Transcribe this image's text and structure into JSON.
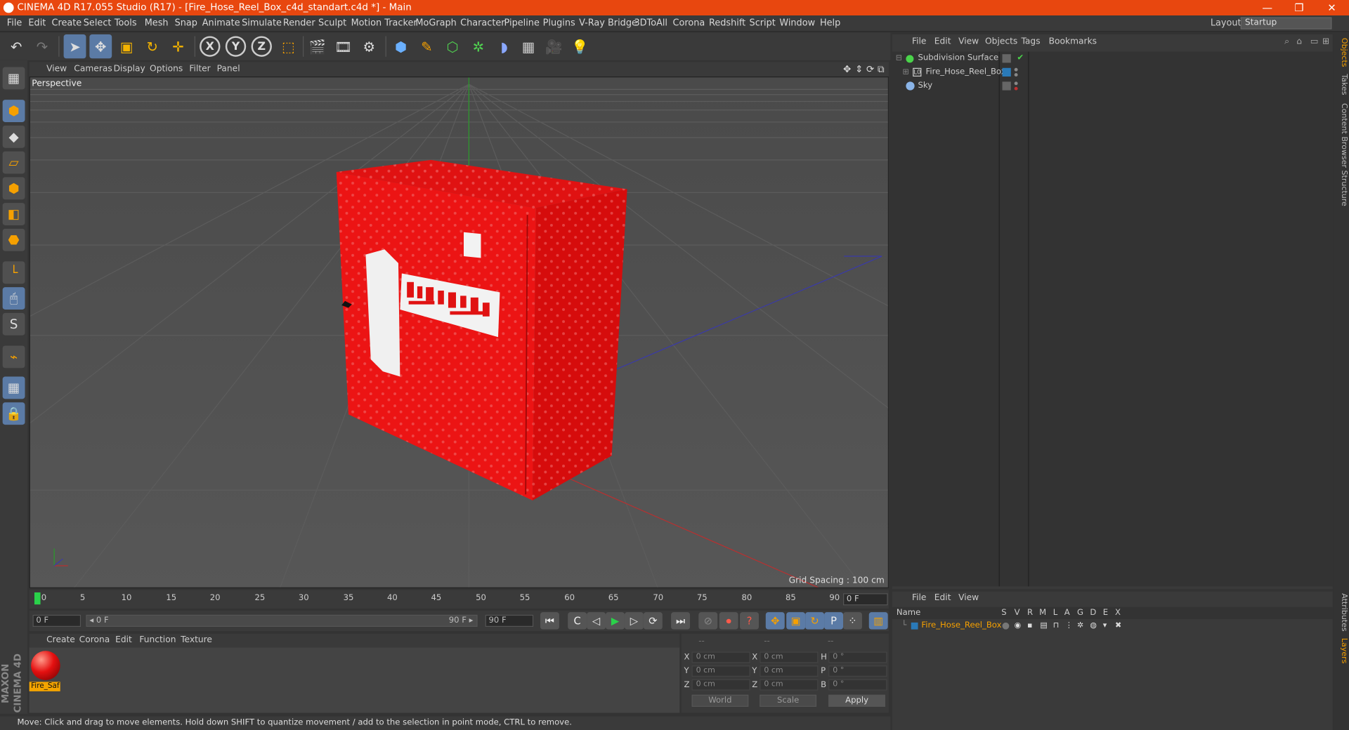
{
  "titlebar": {
    "title": "CINEMA 4D R17.055 Studio (R17) - [Fire_Hose_Reel_Box_c4d_standart.c4d *] - Main",
    "minimize": "—",
    "restore": "❐",
    "close": "✕"
  },
  "menubar": {
    "items": [
      "File",
      "Edit",
      "Create",
      "Select",
      "Tools",
      "Mesh",
      "Snap",
      "Animate",
      "Simulate",
      "Render",
      "Sculpt",
      "Motion Tracker",
      "MoGraph",
      "Character",
      "Pipeline",
      "Plugins",
      "V-Ray Bridge",
      "3DToAll",
      "Corona",
      "Redshift",
      "Script",
      "Window",
      "Help"
    ],
    "layout_label": "Layout:",
    "layout_value": "Startup"
  },
  "toolbar": {
    "undo": "↶",
    "redo": "↷",
    "select": "➤",
    "move": "✥",
    "scale": "▣",
    "rotate": "↻",
    "add": "✛",
    "x": "X",
    "y": "Y",
    "z": "Z",
    "coord": "⬚",
    "render_view": "🎬",
    "render_pv": "🎞",
    "render_settings": "⚙",
    "cube": "⬢",
    "pen": "✎",
    "subdivide": "⬡",
    "mograph": "✲",
    "deformer": "◗",
    "floor": "▦",
    "camera": "🎥",
    "light": "💡"
  },
  "lefttools": {
    "model": "▦",
    "mesh_pts": "◆",
    "edges": "▱",
    "polys": "⬢",
    "uvw": "◧",
    "object": "⬢",
    "texture": "⬣",
    "axis": "└",
    "tweak": "🖱",
    "snap": "S",
    "magnet": "⌁",
    "workplane": "▦",
    "lock": "🔒"
  },
  "maxon_logo": "MAXON CINEMA 4D",
  "viewport": {
    "menu": [
      "View",
      "Cameras",
      "Display",
      "Options",
      "Filter",
      "Panel"
    ],
    "label": "Perspective",
    "grid_spacing": "Grid Spacing : 100 cm",
    "nav": [
      "✥",
      "⇕",
      "⟳",
      "⧉"
    ]
  },
  "timeline": {
    "ticks": [
      "0",
      "5",
      "10",
      "15",
      "20",
      "25",
      "30",
      "35",
      "40",
      "45",
      "50",
      "55",
      "60",
      "65",
      "70",
      "75",
      "80",
      "85",
      "90"
    ],
    "current": "0 F"
  },
  "transport": {
    "start": "0 F",
    "range_start": "◂ 0 F",
    "range_end": "90 F ▸",
    "end": "90 F",
    "buttons": {
      "first": "⏮",
      "prev_key": "C",
      "prev": "◁",
      "play": "▶",
      "next": "▷",
      "loop": "⟳",
      "last": "⏭"
    },
    "rec": {
      "keyframe": "⊘",
      "autokey": "⏺",
      "question": "?",
      "move": "✥",
      "scale": "▣",
      "rotate": "↻",
      "param": "P",
      "dots": "⁘",
      "film": "▥"
    }
  },
  "materials": {
    "menu": [
      "Create",
      "Corona",
      "Edit",
      "Function",
      "Texture"
    ],
    "items": [
      {
        "name": "Fire_Saf"
      }
    ]
  },
  "coords": {
    "header": [
      "--",
      "--",
      "--"
    ],
    "rows": [
      {
        "a": "X",
        "av": "0 cm",
        "b": "X",
        "bv": "0 cm",
        "c": "H",
        "cv": "0 °"
      },
      {
        "a": "Y",
        "av": "0 cm",
        "b": "Y",
        "bv": "0 cm",
        "c": "P",
        "cv": "0 °"
      },
      {
        "a": "Z",
        "av": "0 cm",
        "b": "Z",
        "bv": "0 cm",
        "c": "B",
        "cv": "0 °"
      }
    ],
    "world": "World",
    "scale": "Scale",
    "apply": "Apply"
  },
  "status": "Move: Click and drag to move elements. Hold down SHIFT to quantize movement / add to the selection in point mode, CTRL to remove.",
  "objects": {
    "menu": [
      "File",
      "Edit",
      "View",
      "Objects",
      "Tags",
      "Bookmarks"
    ],
    "rows": [
      {
        "name": "Subdivision Surface"
      },
      {
        "name": "Fire_Hose_Reel_Box"
      },
      {
        "name": "Sky"
      }
    ]
  },
  "rightstrip": [
    "Objects",
    "Takes",
    "Content Browser",
    "Structure",
    "Attributes",
    "Layers"
  ],
  "layers": {
    "menu": [
      "File",
      "Edit",
      "View"
    ],
    "header": [
      "Name",
      "S",
      "V",
      "R",
      "M",
      "L",
      "A",
      "G",
      "D",
      "E",
      "X"
    ],
    "row": "Fire_Hose_Reel_Box"
  },
  "colors": {
    "accent": "#e8470f",
    "object_red": "#e01010",
    "selected_blue": "#5b7ba6",
    "material_tag": "#f4a400"
  }
}
